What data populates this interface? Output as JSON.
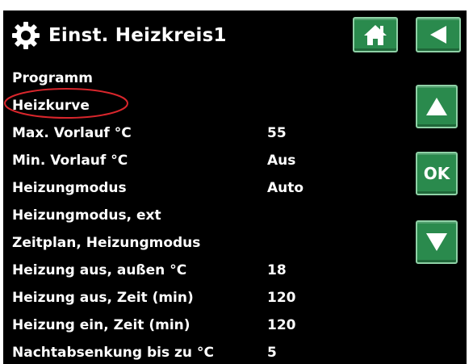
{
  "header": {
    "title": "Einst. Heizkreis1"
  },
  "buttons": {
    "ok_label": "OK"
  },
  "menu": [
    {
      "label": "Programm",
      "value": ""
    },
    {
      "label": "Heizkurve",
      "value": ""
    },
    {
      "label": "Max. Vorlauf °C",
      "value": "55"
    },
    {
      "label": "Min. Vorlauf °C",
      "value": "Aus"
    },
    {
      "label": "Heizungmodus",
      "value": "Auto"
    },
    {
      "label": "Heizungmodus, ext",
      "value": ""
    },
    {
      "label": "Zeitplan, Heizungmodus",
      "value": ""
    },
    {
      "label": "Heizung aus, außen °C",
      "value": "18"
    },
    {
      "label": "Heizung aus, Zeit (min)",
      "value": "120"
    },
    {
      "label": "Heizung ein, Zeit (min)",
      "value": "120"
    },
    {
      "label": "Nachtabsenkung bis zu °C",
      "value": "5"
    }
  ],
  "colors": {
    "background": "#000000",
    "button_green": "#2a8a4d",
    "button_border": "#8fd1a6",
    "annotation_red": "#d9262c"
  },
  "icons": {
    "settings": "gear-icon",
    "home": "home-icon",
    "back": "back-arrow-icon",
    "up": "arrow-up-icon",
    "down": "arrow-down-icon"
  }
}
